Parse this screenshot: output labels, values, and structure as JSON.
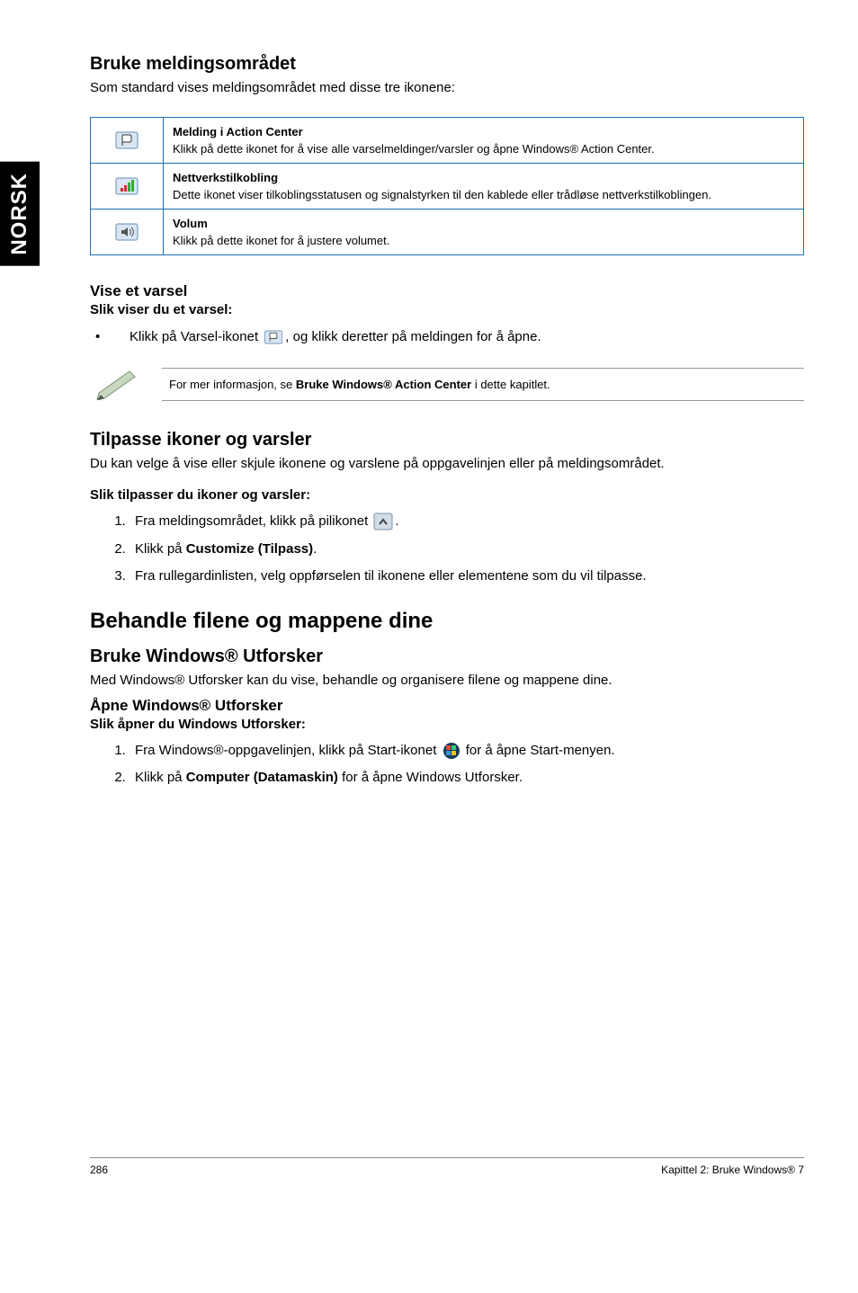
{
  "sideTab": "NORSK",
  "section1": {
    "title": "Bruke meldingsområdet",
    "lead": "Som standard vises meldingsområdet med disse tre ikonene:",
    "rows": [
      {
        "iconName": "action-center-flag-icon",
        "title": "Melding i Action Center",
        "desc": "Klikk på dette ikonet for å vise alle varselmeldinger/varsler og åpne Windows® Action Center."
      },
      {
        "iconName": "network-icon",
        "title": "Nettverkstilkobling",
        "desc": "Dette ikonet viser tilkoblingsstatusen og signalstyrken til den kablede eller trådløse nettverkstilkoblingen."
      },
      {
        "iconName": "volume-icon",
        "title": "Volum",
        "desc": "Klikk på dette ikonet for å justere volumet."
      }
    ]
  },
  "section2": {
    "title": "Vise et varsel",
    "bold": "Slik viser du et varsel:",
    "bullet_pre": "Klikk på Varsel-ikonet ",
    "bullet_post": ", og klikk deretter på meldingen for å åpne.",
    "note_pre": "For mer informasjon, se ",
    "note_bold": "Bruke Windows® Action Center",
    "note_post": " i dette kapitlet."
  },
  "section3": {
    "title": "Tilpasse ikoner og varsler",
    "lead": "Du kan velge å vise eller skjule ikonene og varslene på oppgavelinjen eller på meldingsområdet.",
    "bold": "Slik tilpasser du ikoner og varsler:",
    "step1_pre": "Fra meldingsområdet, klikk på pilikonet ",
    "step1_post": ".",
    "step2_pre": "Klikk på ",
    "step2_bold": "Customize (Tilpass)",
    "step2_post": ".",
    "step3": "Fra rullegardinlisten, velg oppførselen til ikonene eller elementene som du vil tilpasse."
  },
  "major": {
    "title": "Behandle filene og mappene dine"
  },
  "section4": {
    "title": "Bruke Windows® Utforsker",
    "lead": "Med Windows® Utforsker kan du vise, behandle og organisere filene og mappene dine.",
    "sub": "Åpne Windows® Utforsker",
    "bold": "Slik åpner du Windows Utforsker:",
    "step1_pre": "Fra Windows®-oppgavelinjen, klikk på Start-ikonet ",
    "step1_post": " for å åpne Start-menyen.",
    "step2_pre": "Klikk på ",
    "step2_bold": "Computer (Datamaskin)",
    "step2_post": " for å åpne Windows Utforsker."
  },
  "footer": {
    "page": "286",
    "chapter": "Kapittel 2: Bruke Windows® 7"
  }
}
